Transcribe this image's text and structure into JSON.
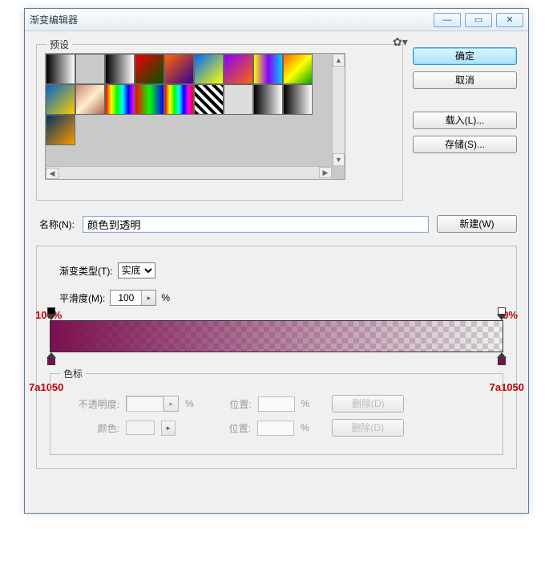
{
  "window": {
    "title": "渐变编辑器"
  },
  "winbuttons": {
    "min_glyph": "—",
    "max_glyph": "▭",
    "close_glyph": "✕"
  },
  "presets": {
    "legend": "预设",
    "gear_glyph": "✿▾"
  },
  "buttons": {
    "ok": "确定",
    "cancel": "取消",
    "load": "载入(L)...",
    "save": "存储(S)...",
    "new": "新建(W)"
  },
  "name": {
    "label": "名称(N):",
    "value": "颜色到透明"
  },
  "gradient": {
    "type_label": "渐变类型(T):",
    "type_value": "实底",
    "smooth_label": "平滑度(M):",
    "smooth_value": "100",
    "smooth_unit": "%"
  },
  "annotations": {
    "left_opacity": "100%",
    "right_opacity": "0%",
    "left_color": "7a1050",
    "right_color": "7a1050"
  },
  "stops": {
    "legend": "色标",
    "opacity_label": "不透明度:",
    "color_label": "颜色:",
    "position_label": "位置:",
    "percent": "%",
    "delete": "删除(D)"
  },
  "chart_data": {
    "type": "gradient",
    "color_stops": [
      {
        "position_pct": 0,
        "hex": "7a1050",
        "opacity_pct": 100
      },
      {
        "position_pct": 100,
        "hex": "7a1050",
        "opacity_pct": 0
      }
    ]
  }
}
